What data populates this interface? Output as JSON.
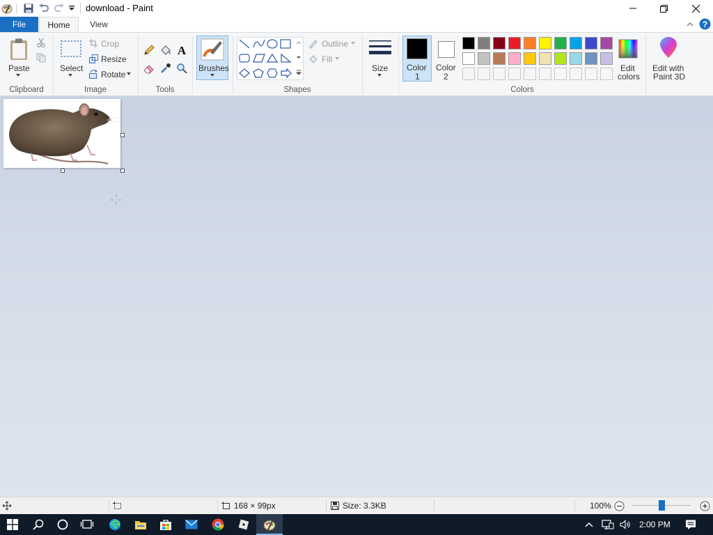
{
  "window": {
    "title": "download - Paint",
    "minimize_label": "Minimize",
    "maximize_label": "Restore",
    "close_label": "Close"
  },
  "tabs": [
    {
      "label": "File"
    },
    {
      "label": "Home"
    },
    {
      "label": "View"
    }
  ],
  "clipboard": {
    "paste_label": "Paste",
    "group_label": "Clipboard"
  },
  "image": {
    "select_label": "Select",
    "crop_label": "Crop",
    "resize_label": "Resize",
    "rotate_label": "Rotate",
    "group_label": "Image"
  },
  "tools": {
    "group_label": "Tools"
  },
  "brushes": {
    "label": "Brushes"
  },
  "shapes": {
    "outline_label": "Outline",
    "fill_label": "Fill",
    "group_label": "Shapes"
  },
  "size": {
    "label": "Size"
  },
  "colors": {
    "color1_label": "Color",
    "color1_num": "1",
    "color2_label": "Color",
    "color2_num": "2",
    "color1_value": "#000000",
    "color2_value": "#ffffff",
    "palette_row1": [
      "#000000",
      "#7f7f7f",
      "#880015",
      "#ed1c24",
      "#ff7f27",
      "#fff200",
      "#22b14c",
      "#00a2e8",
      "#3f48cc",
      "#a349a4"
    ],
    "palette_row2": [
      "#ffffff",
      "#c3c3c3",
      "#b97a57",
      "#ffaec9",
      "#ffc90e",
      "#efe4b0",
      "#b5e61d",
      "#99d9ea",
      "#7092be",
      "#c8bfe7"
    ],
    "palette_row3_count": 10,
    "edit_colors_label1": "Edit",
    "edit_colors_label2": "colors",
    "group_label": "Colors"
  },
  "paint3d": {
    "label1": "Edit with",
    "label2": "Paint 3D"
  },
  "statusbar": {
    "image_size": "168 × 99px",
    "file_size": "Size: 3.3KB",
    "zoom": "100%"
  },
  "taskbar": {
    "clock": "2:00 PM"
  }
}
